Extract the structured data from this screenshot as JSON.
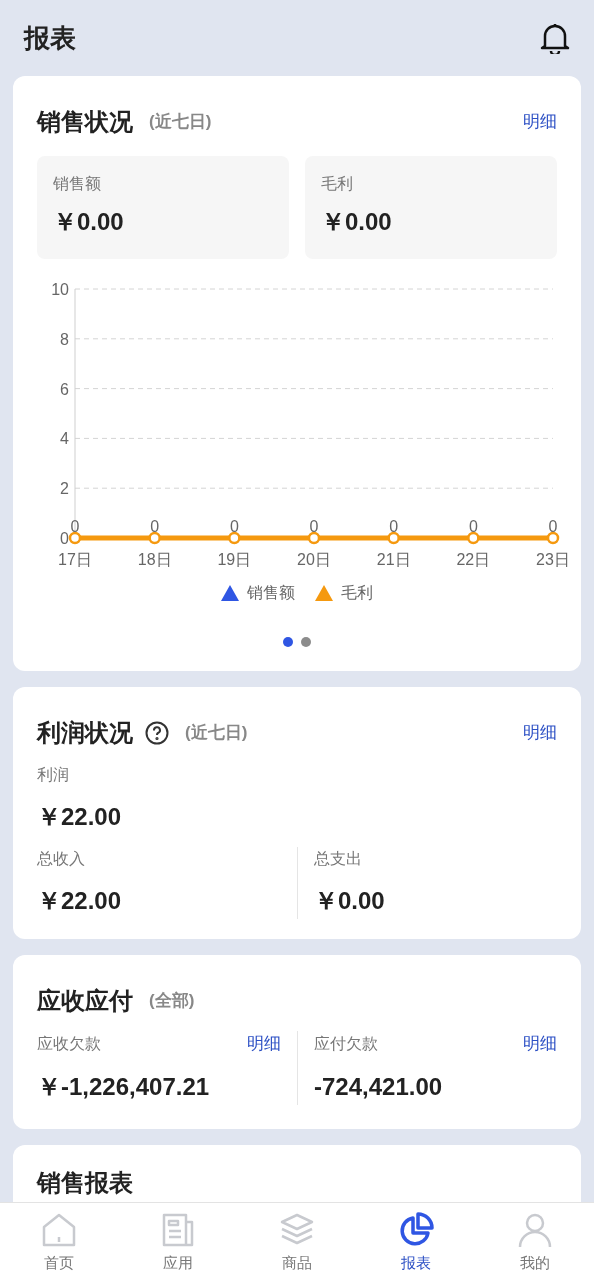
{
  "header": {
    "title": "报表"
  },
  "sales": {
    "title": "销售状况",
    "period": "(近七日)",
    "detail": "明细",
    "stats": [
      {
        "label": "销售额",
        "value": "￥0.00"
      },
      {
        "label": "毛利",
        "value": "￥0.00"
      }
    ],
    "chart_data": {
      "type": "line",
      "categories": [
        "17日",
        "18日",
        "19日",
        "20日",
        "21日",
        "22日",
        "23日"
      ],
      "ylim": [
        0,
        10
      ],
      "yticks": [
        0,
        2,
        4,
        6,
        8,
        10
      ],
      "data_labels": true,
      "grid": true,
      "series": [
        {
          "name": "销售额",
          "color": "#2f56e3",
          "values": [
            null,
            null,
            null,
            null,
            null,
            null,
            null
          ]
        },
        {
          "name": "毛利",
          "color": "#f5990f",
          "marker": "circle",
          "values": [
            0,
            0,
            0,
            0,
            0,
            0,
            0
          ]
        }
      ]
    },
    "pages": [
      {
        "selected": true
      },
      {
        "selected": false
      }
    ]
  },
  "profit": {
    "title": "利润状况",
    "period": "(近七日)",
    "detail": "明细",
    "main_label": "利润",
    "main_value": "￥22.00",
    "stats": [
      {
        "label": "总收入",
        "value": "￥22.00"
      },
      {
        "label": "总支出",
        "value": "￥0.00"
      }
    ]
  },
  "ar_ap": {
    "title": "应收应付",
    "period": "(全部)",
    "stats": [
      {
        "label": "应收欠款",
        "value": "￥-1,226,407.21",
        "detail": "明细"
      },
      {
        "label": "应付欠款",
        "value": "-724,421.00",
        "detail": "明细"
      }
    ]
  },
  "sales_report": {
    "title": "销售报表"
  },
  "tabbar": [
    {
      "kind": "home",
      "label": "首页",
      "selected": false
    },
    {
      "kind": "apps",
      "label": "应用",
      "selected": false
    },
    {
      "kind": "goods",
      "label": "商品",
      "selected": false
    },
    {
      "kind": "report",
      "label": "报表",
      "selected": true
    },
    {
      "kind": "me",
      "label": "我的",
      "selected": false
    }
  ]
}
